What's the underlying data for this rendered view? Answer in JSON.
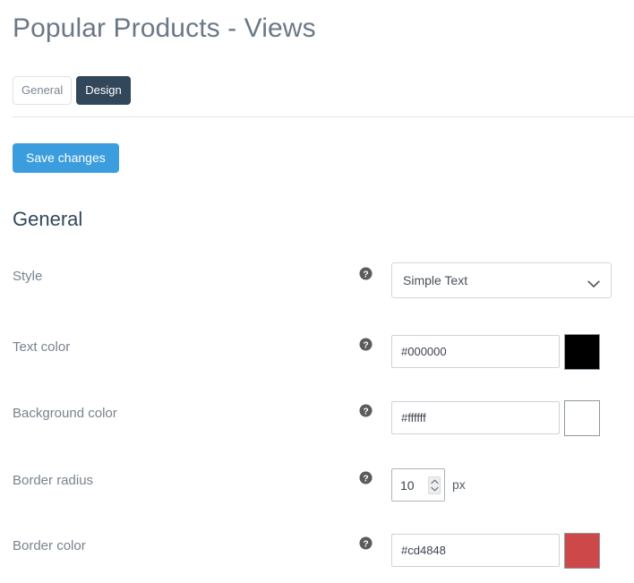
{
  "header": {
    "title": "Popular Products - Views"
  },
  "tabs": [
    {
      "label": "General",
      "active": false
    },
    {
      "label": "Design",
      "active": true
    }
  ],
  "toolbar": {
    "save_label": "Save changes"
  },
  "section": {
    "heading": "General"
  },
  "form": {
    "help_icon": "help-circle-icon",
    "rows": [
      {
        "label": "Style",
        "type": "select",
        "value": "Simple Text",
        "chevron_icon": "chevron-down-icon"
      },
      {
        "label": "Text color",
        "type": "color",
        "value": "#000000",
        "swatch": "#000000"
      },
      {
        "label": "Background color",
        "type": "color",
        "value": "#ffffff",
        "swatch": "#ffffff"
      },
      {
        "label": "Border radius",
        "type": "number",
        "value": "10",
        "unit": "px",
        "spinner_up_icon": "chevron-up-icon",
        "spinner_down_icon": "chevron-down-icon"
      },
      {
        "label": "Border color",
        "type": "color",
        "value": "#cd4848",
        "swatch": "#cd4848"
      }
    ]
  },
  "colors": {
    "accent_blue": "#3b9ddd",
    "tab_active_bg": "#33475b",
    "heading": "#33475b",
    "title": "#6a7887",
    "label": "#78838f"
  }
}
